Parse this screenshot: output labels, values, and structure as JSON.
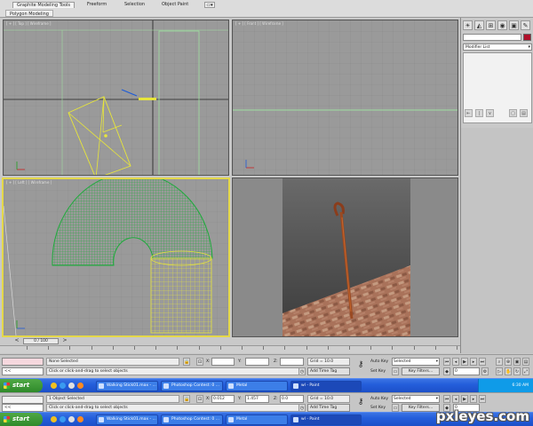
{
  "ribbon": {
    "tabs": [
      {
        "label": "Graphite Modeling Tools",
        "active": true
      },
      {
        "label": "Freeform",
        "active": false
      },
      {
        "label": "Selection",
        "active": false
      },
      {
        "label": "Object Paint",
        "active": false
      }
    ],
    "sub_tab": "Polygon Modeling"
  },
  "viewports": {
    "top": "[ + ] [ Top ] [ Wireframe ]",
    "front": "[ + ] [ Front ] [ Wireframe ]",
    "left": "[ + ] [ Left ] [ Wireframe ]",
    "camera": "[ + ] [ Camera001 ] [ Smooth + Highlights ]"
  },
  "command_panel": {
    "modifier_list": "Modifier List"
  },
  "timeline": {
    "frame_label": "0 / 100",
    "ticks": [
      "0",
      "5",
      "10",
      "15",
      "20",
      "25",
      "30",
      "35",
      "40",
      "45",
      "50",
      "55",
      "60",
      "65",
      "70",
      "75",
      "80",
      "85",
      "90",
      "95",
      "100"
    ]
  },
  "status_top": {
    "selection": "None Selected",
    "prompt": "Click or click-and-drag to select objects",
    "x_label": "X:",
    "x_value": "",
    "y_label": "Y:",
    "y_value": "",
    "z_label": "Z:",
    "z_value": "",
    "grid": "Grid = 10.0",
    "add_time_tag": "Add Time Tag",
    "auto_key": "Auto Key",
    "auto_key_select": "Selected",
    "set_key": "Set Key",
    "key_filters": "Key Filters...",
    "frame_value": "0",
    "script_prompt": "<<"
  },
  "taskbar_top": {
    "start": "start",
    "tasks": [
      {
        "label": "Walking Stick01.max - ...",
        "active": false
      },
      {
        "label": "Photoshop Contest: 0 ...",
        "active": false
      },
      {
        "label": "Metal",
        "active": false
      },
      {
        "label": "wl - Paint",
        "active": true
      }
    ],
    "clock": "6:30 AM"
  },
  "status_bottom": {
    "selection": "1 Object Selected",
    "prompt": "Click or click-and-drag to select objects",
    "x_label": "X:",
    "x_value": "0.012",
    "y_label": "Y:",
    "y_value": "1.457",
    "z_label": "Z:",
    "z_value": "0.0",
    "grid": "Grid = 10.0",
    "add_time_tag": "Add Time Tag",
    "auto_key": "Auto Key",
    "auto_key_select": "Selected",
    "set_key": "Set Key",
    "key_filters": "Key Filters...",
    "frame_value": "0",
    "script_prompt": "<<"
  },
  "taskbar_bottom": {
    "start": "start",
    "tasks": [
      {
        "label": "Walking Stick01.max - ...",
        "active": false
      },
      {
        "label": "Photoshop Contest: 0 ...",
        "active": false
      },
      {
        "label": "Metal",
        "active": false
      },
      {
        "label": "wl - Paint",
        "active": true
      }
    ]
  },
  "watermark": "pxleyes.com",
  "colors": {
    "viewport_bg": "#9a9a9a",
    "active_border": "#e4d84a",
    "wire_green": "#1faa3c",
    "wire_yellow": "#e8e63a",
    "taskbar_blue": "#245edb",
    "start_green": "#3a9a34"
  }
}
